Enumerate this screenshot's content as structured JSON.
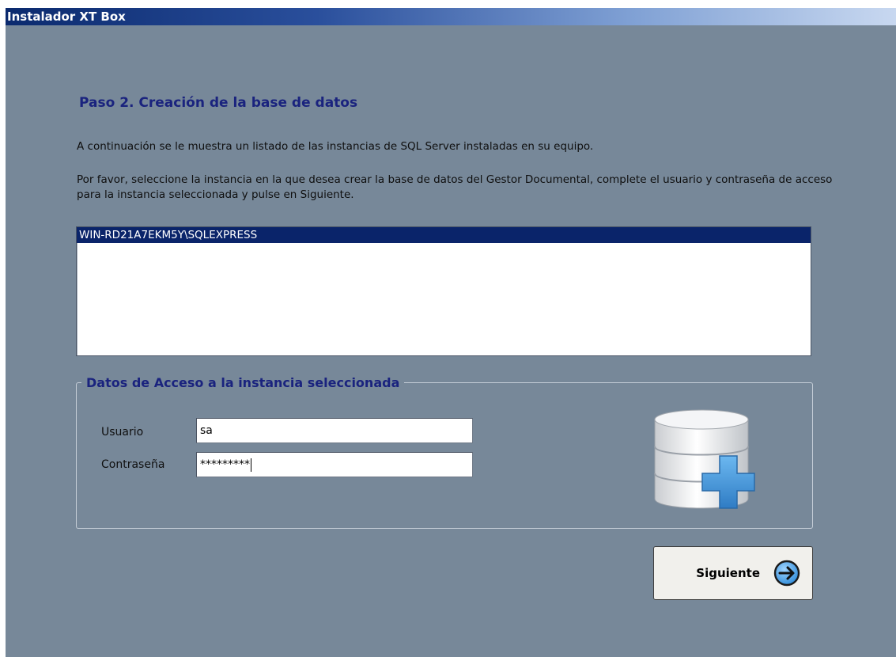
{
  "window": {
    "title": "Instalador XT Box"
  },
  "step": {
    "title": "Paso 2. Creación de la base de datos",
    "intro": "A continuación se le muestra un listado de las instancias de SQL Server instaladas en su equipo.",
    "description": "Por favor, seleccione la instancia en la que desea crear la base de datos del Gestor Documental, complete el usuario y contraseña de acceso para la instancia seleccionada y pulse en Siguiente."
  },
  "instances": {
    "items": [
      "WIN-RD21A7EKM5Y\\SQLEXPRESS"
    ],
    "selected": "WIN-RD21A7EKM5Y\\SQLEXPRESS"
  },
  "access": {
    "group_title": "Datos de Acceso a la instancia seleccionada",
    "user_label": "Usuario",
    "user_value": "sa",
    "password_label": "Contraseña",
    "password_value": "*********"
  },
  "actions": {
    "next_label": "Siguiente"
  },
  "icons": {
    "database": "database-add-icon",
    "next": "arrow-right-circle-icon"
  },
  "colors": {
    "background": "#778899",
    "heading": "#1a237e",
    "selection": "#0a246a",
    "icon_blue": "#3f8fd6"
  }
}
